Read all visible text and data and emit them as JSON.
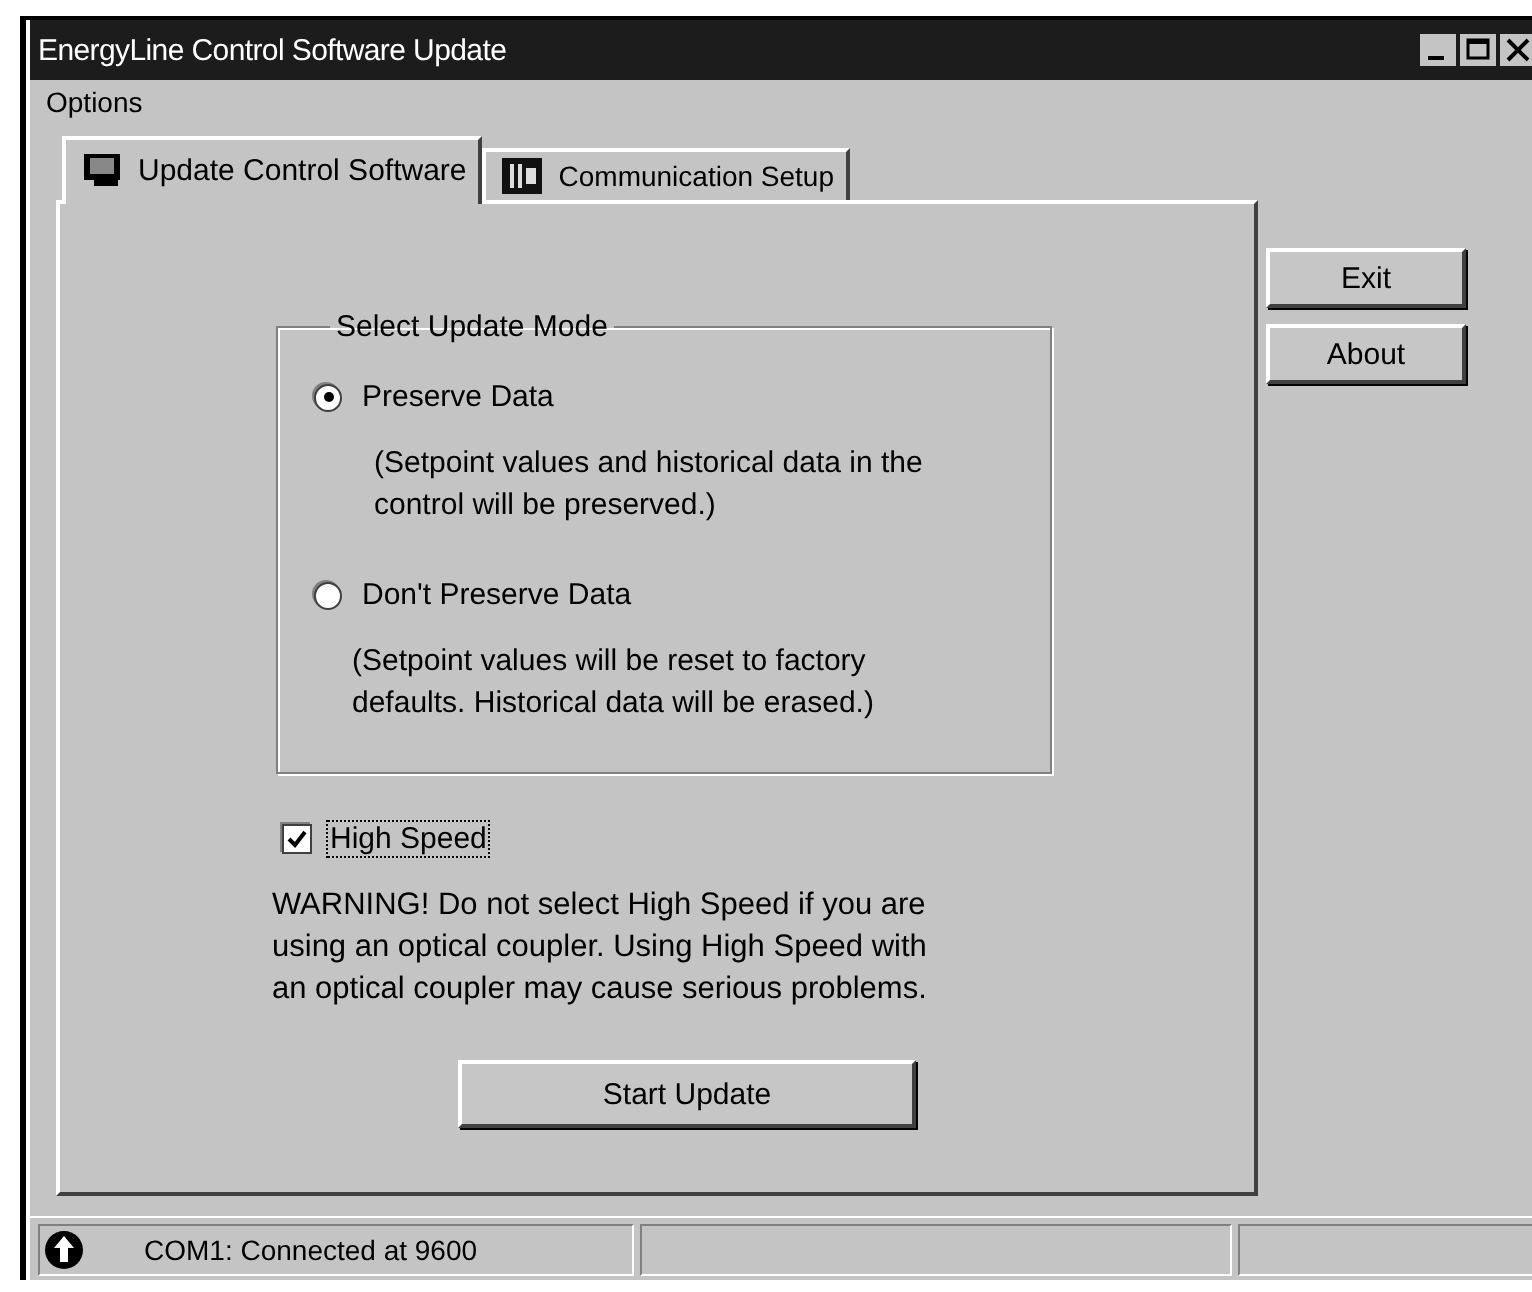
{
  "window": {
    "title": "EnergyLine Control Software Update"
  },
  "menu": [
    "Options"
  ],
  "tabs": [
    {
      "label": "Update Control Software",
      "selected": true
    },
    {
      "label": "Communication Setup",
      "selected": false
    }
  ],
  "update_mode": {
    "title": "Select Update Mode",
    "options": [
      {
        "label": "Preserve Data",
        "selected": true,
        "description": "(Setpoint values and historical data in the\ncontrol will be preserved.)"
      },
      {
        "label": "Don't Preserve Data",
        "selected": false,
        "description": "(Setpoint values will be reset to factory\ndefaults. Historical data will be erased.)"
      }
    ]
  },
  "high_speed": {
    "label": "High Speed",
    "checked": true
  },
  "warning": "WARNING! Do not select High Speed if you are\nusing an optical coupler. Using High Speed with\nan optical coupler may cause serious problems.",
  "start_button": "Start Update",
  "side_buttons": [
    "Exit",
    "About"
  ],
  "status_bar": {
    "text": "COM1: Connected at 9600"
  }
}
